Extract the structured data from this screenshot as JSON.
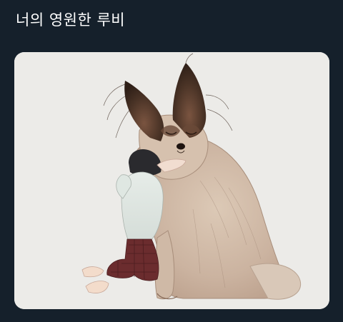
{
  "post": {
    "text": "너의 영원한 루비"
  },
  "media": {
    "description_icon": "illustration-image",
    "colors": {
      "background": "#15202b",
      "paper": "#ecebe8",
      "dog_fur": "#cdb9a8",
      "ear_dark": "#4a3326",
      "pants": "#6b2c2e",
      "hair": "#2a2a2e"
    }
  }
}
